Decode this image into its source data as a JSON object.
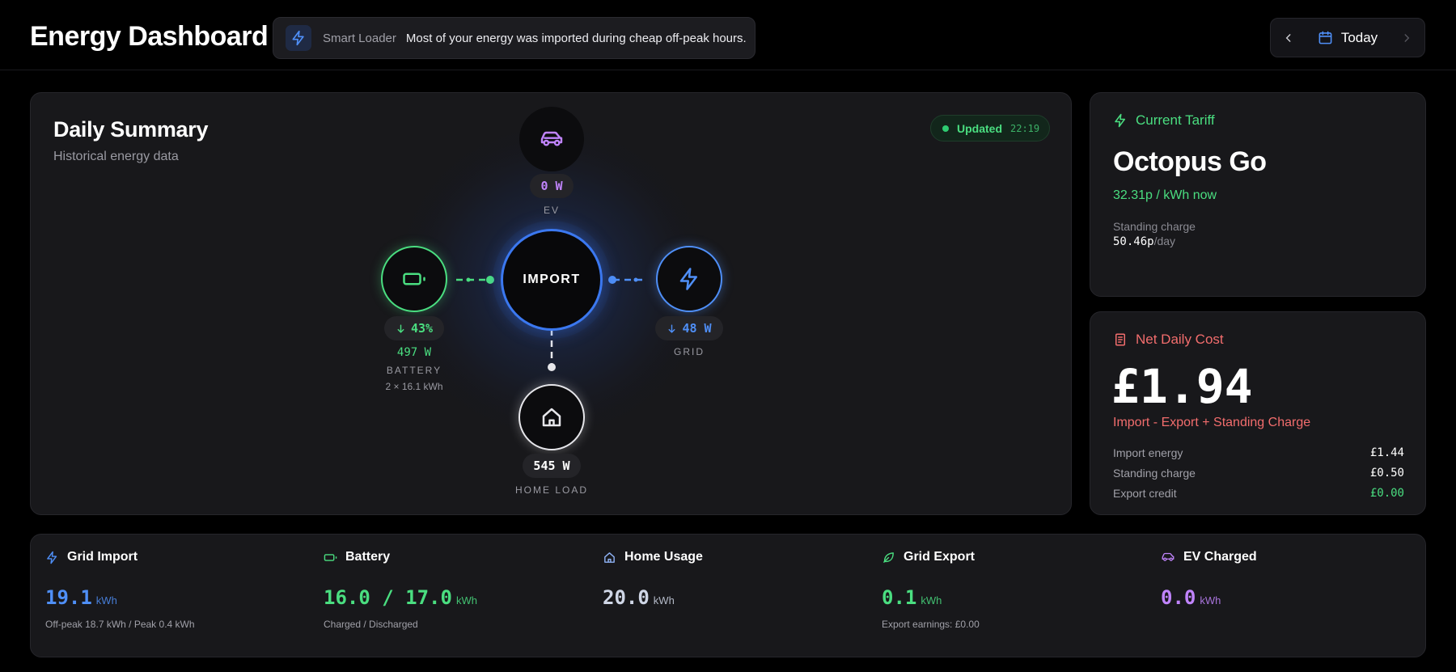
{
  "app": {
    "title": "Energy Dashboard"
  },
  "banner": {
    "label": "Smart Loader",
    "text": "Most of your energy was imported during cheap off-peak hours."
  },
  "date_nav": {
    "label": "Today"
  },
  "summary": {
    "title": "Daily Summary",
    "subtitle": "Historical energy data",
    "updated_label": "Updated",
    "updated_time": "22:19",
    "center_label": "IMPORT",
    "ev": {
      "value": "0 W",
      "caption": "EV"
    },
    "battery": {
      "percent": "43%",
      "power": "497 W",
      "caption": "BATTERY",
      "capacity": "2 × 16.1 kWh"
    },
    "grid": {
      "value": "48 W",
      "caption": "GRID"
    },
    "home": {
      "value": "545 W",
      "caption": "HOME LOAD"
    }
  },
  "tariff": {
    "heading": "Current Tariff",
    "name": "Octopus Go",
    "rate": "32.31p / kWh now",
    "standing_label": "Standing charge",
    "standing_value": "50.46p",
    "standing_unit": "/day"
  },
  "cost": {
    "heading": "Net Daily Cost",
    "amount": "£1.94",
    "formula": "Import - Export + Standing Charge",
    "rows": [
      {
        "label": "Import energy",
        "value": "£1.44"
      },
      {
        "label": "Standing charge",
        "value": "£0.50"
      },
      {
        "label": "Export credit",
        "value": "£0.00"
      }
    ]
  },
  "stats": [
    {
      "title": "Grid Import",
      "value": "19.1",
      "unit": "kWh",
      "note": "Off-peak 18.7 kWh / Peak 0.4 kWh"
    },
    {
      "title": "Battery",
      "value": "16.0 / 17.0",
      "unit": "kWh",
      "note": "Charged / Discharged"
    },
    {
      "title": "Home Usage",
      "value": "20.0",
      "unit": "kWh",
      "note": ""
    },
    {
      "title": "Grid Export",
      "value": "0.1",
      "unit": "kWh",
      "note": "Export earnings: £0.00"
    },
    {
      "title": "EV Charged",
      "value": "0.0",
      "unit": "kWh",
      "note": ""
    }
  ],
  "colors": {
    "grid": "#4f8ff7",
    "battery": "#4ade80",
    "ev": "#c084fc",
    "cost": "#f26d6d",
    "home": "#cfd6e6"
  }
}
